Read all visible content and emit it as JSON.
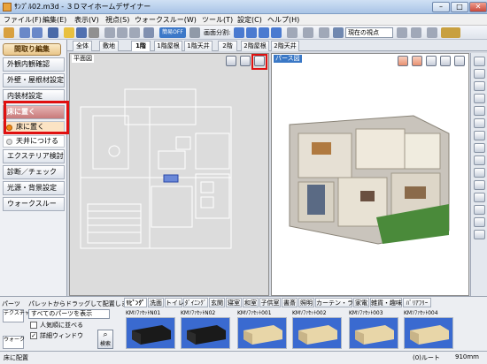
{
  "window": {
    "title": "ｻﾝﾌﾟﾙ02.m3d - ３Ｄマイホームデザイナー",
    "minimize": "–",
    "maximize": "□",
    "close": "✕"
  },
  "menu": [
    "ファイル(F)",
    "編集(E)",
    "表示(V)",
    "視点(S)",
    "ウォークスルー(W)",
    "ツール(T)",
    "設定(C)",
    "ヘルプ(H)"
  ],
  "toolbar": {
    "viewpoint": "現在の視点",
    "toggle_label": "簡易OFF",
    "screen_split_label": "画面分割:"
  },
  "left_panel": {
    "tab": "間取り編集",
    "items": [
      "外観内観確認",
      "外壁・屋根材設定",
      "内装材設定",
      "家具配置"
    ],
    "sub_items": [
      "床に置く",
      "天井につける"
    ],
    "items2": [
      "エクステリア検討",
      "診断／チェック",
      "光源・背景設定",
      "ウォークスルー"
    ]
  },
  "floor_tabs": [
    "全体",
    "敷地",
    "1階",
    "1階屋根",
    "1階天井",
    "2階",
    "2階屋根",
    "2階天井"
  ],
  "plan_view": {
    "label": "平面図"
  },
  "persp_view": {
    "label": "パース図"
  },
  "parts": {
    "label": "パーツ",
    "hint": "パレットからドラッグして配置します。",
    "filter": "すべてのパーツを表示",
    "check1": "人気順に並べる",
    "check2": "詳細ウィンドウ",
    "search": "検索",
    "side_tabs": [
      "テクスチャ",
      "ウォーク"
    ],
    "categories": [
      "ﾘﾋﾞﾝｸﾞ",
      "洗面",
      "トイレ",
      "ﾀﾞｲﾆﾝｸﾞ",
      "玄関",
      "寝室",
      "和室",
      "子供室",
      "書斎",
      "照明",
      "カーテン・ラグ",
      "家電",
      "雑貨・趣味",
      "ﾊﾞﾘｱﾌﾘｰ"
    ],
    "items": [
      "KMｿﾌｧｾｯﾄN01",
      "KMｿﾌｧｾｯﾄN02",
      "KMｿﾌｧｾｯﾄ001",
      "KMｿﾌｧｾｯﾄ002",
      "KMｿﾌｧｾｯﾄ003",
      "KMｿﾌｧｾｯﾄ004"
    ]
  },
  "status": {
    "left": "床に配置",
    "mid": "(0)ルート",
    "right": "910mm"
  }
}
